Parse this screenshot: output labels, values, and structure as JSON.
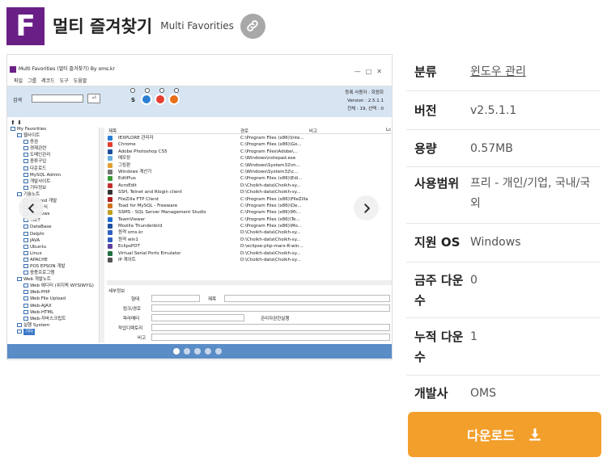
{
  "header": {
    "icon_letter": "F",
    "title": "멀티 즐겨찾기",
    "subtitle": "Multi Favorities",
    "link_icon": "link-icon"
  },
  "screenshot": {
    "window_title": "Multi Favorities (멀티 즐겨찾기) By oms.kr",
    "menu": [
      "파일",
      "그룹",
      "레코드",
      "도구",
      "도움말"
    ],
    "search_label": "검색",
    "search_button": "⏎",
    "s_label": "S",
    "user_line1": "등록 사용자 : 회원회",
    "user_line2": "Version : 2.5.1.1",
    "user_line3": "전체 : 19, 선택 : 0",
    "tree": [
      {
        "t": "My Favorities",
        "lvl": 0
      },
      {
        "t": "웹사이트",
        "lvl": 1
      },
      {
        "t": "증권",
        "lvl": 2
      },
      {
        "t": "경제관련",
        "lvl": 2
      },
      {
        "t": "도메인관리",
        "lvl": 2
      },
      {
        "t": "종류구입",
        "lvl": 2
      },
      {
        "t": "다운로드",
        "lvl": 2
      },
      {
        "t": "MySQL Admin",
        "lvl": 2
      },
      {
        "t": "개발사이트",
        "lvl": 2
      },
      {
        "t": "기타정보",
        "lvl": 2
      },
      {
        "t": "기술노트",
        "lvl": 1
      },
      {
        "t": "Android 개발",
        "lvl": 2
      },
      {
        "t": "기타 지식",
        "lvl": 2
      },
      {
        "t": "Windows",
        "lvl": 2
      },
      {
        "t": ".NET",
        "lvl": 2
      },
      {
        "t": "DataBase",
        "lvl": 2
      },
      {
        "t": "Delphi",
        "lvl": 2
      },
      {
        "t": "JAVA",
        "lvl": 2
      },
      {
        "t": "Ubuntu",
        "lvl": 2
      },
      {
        "t": "Linux",
        "lvl": 2
      },
      {
        "t": "APACHE",
        "lvl": 2
      },
      {
        "t": "POS EPSON 개발",
        "lvl": 2
      },
      {
        "t": "응용프로그램",
        "lvl": 2
      },
      {
        "t": "Web 개발노트",
        "lvl": 1
      },
      {
        "t": "Web 에디터 (위지윅 WYSIWYG)",
        "lvl": 2
      },
      {
        "t": "Web-PHP",
        "lvl": 2
      },
      {
        "t": "Web File Upload",
        "lvl": 2
      },
      {
        "t": "Web-AJAX",
        "lvl": 2
      },
      {
        "t": "Web-HTML",
        "lvl": 2
      },
      {
        "t": "Web-자바스크립트",
        "lvl": 2
      },
      {
        "t": "실행 System",
        "lvl": 1
      },
      {
        "t": "기타",
        "lvl": 1
      }
    ],
    "list_headers": [
      "제목",
      "경로",
      "비고",
      "Lc"
    ],
    "list": [
      {
        "n": "IEXPLORE 관리자",
        "p": "C:\\Program Files (x86)\\Inte..."
      },
      {
        "n": "Chrome",
        "p": "C:\\Program Files (x86)\\Go..."
      },
      {
        "n": "Adobe Photoshop CS5",
        "p": "C:\\Program Files\\Adobe\\..."
      },
      {
        "n": "메모장",
        "p": "C:\\Windows\\notepad.exe"
      },
      {
        "n": "그림판",
        "p": "C:\\Windows\\System32\\m..."
      },
      {
        "n": "Windows 계산기",
        "p": "C:\\Windows\\System32\\c..."
      },
      {
        "n": "EditPlus",
        "p": "C:\\Program Files (x86)\\Edi..."
      },
      {
        "n": "AcroEdit",
        "p": "D:\\Choikh-data\\Choikh-sy..."
      },
      {
        "n": "SSH, Telnet and Rlogin client",
        "p": "D:\\Choikh-data\\Choikh-sy..."
      },
      {
        "n": "FileZilla FTP Client",
        "p": "C:\\Program Files (x86)\\FileZilla"
      },
      {
        "n": "Toad for MySQL - Freeware",
        "p": "C:\\Program Files (x86)\\De..."
      },
      {
        "n": "SSMS - SQL Server Management Studio",
        "p": "C:\\Program Files (x86)\\Mi..."
      },
      {
        "n": "TeamViewer",
        "p": "C:\\Program Files (x86)\\Te..."
      },
      {
        "n": "Mozilla Thunderbird",
        "p": "C:\\Program Files (x86)\\Mo..."
      },
      {
        "n": "원격 oms.kr",
        "p": "D:\\Choikh-data\\Choikh-sy..."
      },
      {
        "n": "원격 win1",
        "p": "D:\\Choikh-data\\Choikh-sy..."
      },
      {
        "n": "EclipsPDT",
        "p": "D:\\eclipse-php-mars-R-win..."
      },
      {
        "n": "Virtual Serial Ports Emulator",
        "p": "D:\\Choikh-data\\Choikh-sy..."
      },
      {
        "n": "IP 계이트",
        "p": "D:\\Choikh-data\\Choikh-sy..."
      }
    ],
    "detail_title": "세부정보",
    "detail_labels": [
      "형태",
      "링크/경로",
      "파라메터",
      "작업디렉토리",
      "비고"
    ],
    "detail_jemok": "제목",
    "detail_admin": "관리자권한실행",
    "dots_count": 5
  },
  "info": [
    {
      "key": "분류",
      "value": "윈도우 관리",
      "link": true
    },
    {
      "key": "버전",
      "value": "v2.5.1.1"
    },
    {
      "key": "용량",
      "value": "0.57MB"
    },
    {
      "key": "사용범위",
      "value": "프리 - 개인/기업, 국내/국외"
    },
    {
      "key": "지원 OS",
      "value": "Windows"
    },
    {
      "key": "금주 다운수",
      "value": "0"
    },
    {
      "key": "누적 다운수",
      "value": "1"
    },
    {
      "key": "개발사",
      "value": "OMS"
    }
  ],
  "download": {
    "label": "다운로드",
    "icon": "download-icon"
  },
  "colors": {
    "brand": "#6a1f86",
    "accent": "#f39f2c"
  }
}
